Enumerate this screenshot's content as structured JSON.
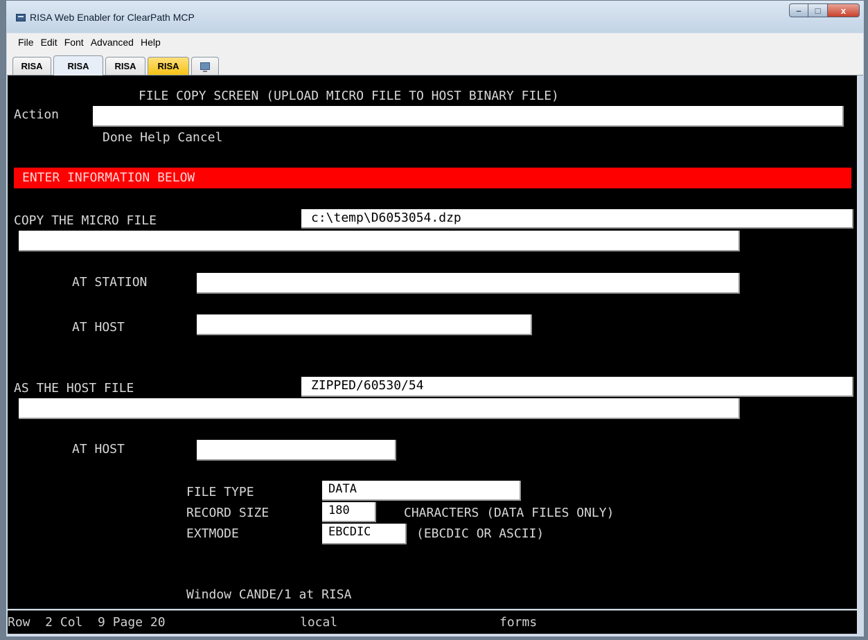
{
  "window": {
    "title": "RISA Web Enabler for ClearPath MCP",
    "minimize_label": "–",
    "maximize_label": "□",
    "close_label": "x"
  },
  "menu": [
    "File",
    "Edit",
    "Font",
    "Advanced",
    "Help"
  ],
  "tabs": [
    {
      "label": "RISA",
      "state": "normal"
    },
    {
      "label": "RISA",
      "state": "active"
    },
    {
      "label": "RISA",
      "state": "normal"
    },
    {
      "label": "RISA",
      "state": "alert"
    }
  ],
  "icons": {
    "tab_extra": "monitor-icon"
  },
  "screen": {
    "title": "FILE COPY SCREEN (UPLOAD MICRO FILE TO HOST BINARY FILE)",
    "action_label": "Action",
    "action_value": "",
    "action_options": "Done Help Cancel",
    "banner": "ENTER INFORMATION BELOW",
    "micro_file_label": "COPY THE MICRO FILE",
    "micro_file_value": "c:\\temp\\D6053054.dzp",
    "micro_file_cont_value": "",
    "at_station_label": "AT STATION",
    "at_station_value": "",
    "at_host_label_1": "AT HOST",
    "at_host_value_1": "",
    "host_file_label": "AS THE HOST FILE",
    "host_file_value": "ZIPPED/60530/54",
    "host_file_cont_value": "",
    "at_host_label_2": "AT HOST",
    "at_host_value_2": "",
    "file_type_label": "FILE TYPE",
    "file_type_value": "DATA",
    "record_size_label": "RECORD SIZE",
    "record_size_value": "180",
    "record_size_note": "CHARACTERS (DATA FILES ONLY)",
    "extmode_label": "EXTMODE",
    "extmode_value": "EBCDIC",
    "extmode_note": "(EBCDIC OR ASCII)",
    "window_info": "Window CANDE/1 at RISA"
  },
  "status": {
    "position": "Row  2 Col  9 Page 20",
    "mode": "local",
    "type": "forms"
  },
  "colors": {
    "terminal_bg": "#000000",
    "terminal_text": "#d8d8d8",
    "banner_bg": "#ff0000",
    "field_bg": "#ffffff",
    "alert_tab": "#f5c215"
  }
}
